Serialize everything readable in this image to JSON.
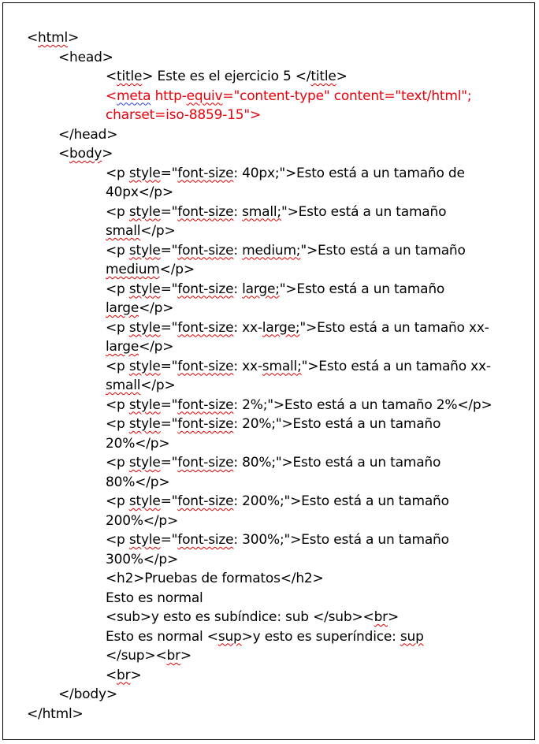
{
  "lines": [
    {
      "indent": 0,
      "red": false,
      "parts": [
        {
          "t": "<"
        },
        {
          "t": "html",
          "sq": 1
        },
        {
          "t": ">"
        }
      ]
    },
    {
      "indent": 1,
      "red": false,
      "parts": [
        {
          "t": "<head>"
        }
      ]
    },
    {
      "indent": 2,
      "red": false,
      "parts": [
        {
          "t": "<"
        },
        {
          "t": "title",
          "sq": 1
        },
        {
          "t": "> Este es el ejercicio 5 </"
        },
        {
          "t": "title",
          "sq": 1
        },
        {
          "t": ">"
        }
      ]
    },
    {
      "indent": 2,
      "red": true,
      "parts": [
        {
          "t": "<"
        },
        {
          "t": "meta",
          "sq": 2
        },
        {
          "t": " http-"
        },
        {
          "t": "equiv",
          "sq": 1
        },
        {
          "t": "=\"content-type\" content=\"text/html\";"
        }
      ]
    },
    {
      "indent": 2,
      "red": true,
      "parts": [
        {
          "t": "charset=iso-8859-15\">"
        }
      ]
    },
    {
      "indent": 1,
      "red": false,
      "parts": [
        {
          "t": "</head>"
        }
      ]
    },
    {
      "indent": 1,
      "red": false,
      "parts": [
        {
          "t": "<"
        },
        {
          "t": "body",
          "sq": 1
        },
        {
          "t": ">"
        }
      ]
    },
    {
      "indent": 2,
      "red": false,
      "parts": [
        {
          "t": "<p "
        },
        {
          "t": "style",
          "sq": 1
        },
        {
          "t": "=\""
        },
        {
          "t": "font-size",
          "sq": 1
        },
        {
          "t": ": 40px;\">Esto está a un tamaño de"
        }
      ]
    },
    {
      "indent": 2,
      "red": false,
      "parts": [
        {
          "t": "40px</p>"
        }
      ]
    },
    {
      "indent": 2,
      "red": false,
      "parts": [
        {
          "t": "<p "
        },
        {
          "t": "style",
          "sq": 1
        },
        {
          "t": "=\""
        },
        {
          "t": "font-size",
          "sq": 1
        },
        {
          "t": ": "
        },
        {
          "t": "small;",
          "sq": 1
        },
        {
          "t": "\">Esto está a un tamaño"
        }
      ]
    },
    {
      "indent": 2,
      "red": false,
      "parts": [
        {
          "t": "small",
          "sq": 1
        },
        {
          "t": "</p>"
        }
      ]
    },
    {
      "indent": 2,
      "red": false,
      "parts": [
        {
          "t": "<p "
        },
        {
          "t": "style",
          "sq": 1
        },
        {
          "t": "=\""
        },
        {
          "t": "font-size",
          "sq": 1
        },
        {
          "t": ": "
        },
        {
          "t": "medium;",
          "sq": 1
        },
        {
          "t": "\">Esto está a un tamaño"
        }
      ]
    },
    {
      "indent": 2,
      "red": false,
      "parts": [
        {
          "t": "medium",
          "sq": 1
        },
        {
          "t": "</p>"
        }
      ]
    },
    {
      "indent": 2,
      "red": false,
      "parts": [
        {
          "t": "<p "
        },
        {
          "t": "style",
          "sq": 1
        },
        {
          "t": "=\""
        },
        {
          "t": "font-size",
          "sq": 1
        },
        {
          "t": ": "
        },
        {
          "t": "large;",
          "sq": 1
        },
        {
          "t": "\">Esto está a un tamaño"
        }
      ]
    },
    {
      "indent": 2,
      "red": false,
      "parts": [
        {
          "t": "large",
          "sq": 1
        },
        {
          "t": "</p>"
        }
      ]
    },
    {
      "indent": 2,
      "red": false,
      "parts": [
        {
          "t": "<p "
        },
        {
          "t": "style",
          "sq": 1
        },
        {
          "t": "=\""
        },
        {
          "t": "font-size",
          "sq": 1
        },
        {
          "t": ": xx-"
        },
        {
          "t": "large;",
          "sq": 1
        },
        {
          "t": "\">Esto está a un tamaño xx-"
        }
      ]
    },
    {
      "indent": 2,
      "red": false,
      "parts": [
        {
          "t": "large",
          "sq": 1
        },
        {
          "t": "</p>"
        }
      ]
    },
    {
      "indent": 2,
      "red": false,
      "parts": [
        {
          "t": "<p "
        },
        {
          "t": "style",
          "sq": 1
        },
        {
          "t": "=\""
        },
        {
          "t": "font-size",
          "sq": 1
        },
        {
          "t": ": xx-"
        },
        {
          "t": "small;",
          "sq": 1
        },
        {
          "t": "\">Esto está a un tamaño xx-"
        }
      ]
    },
    {
      "indent": 2,
      "red": false,
      "parts": [
        {
          "t": "small",
          "sq": 1
        },
        {
          "t": "</p>"
        }
      ]
    },
    {
      "indent": 2,
      "red": false,
      "parts": [
        {
          "t": "<p "
        },
        {
          "t": "style",
          "sq": 1
        },
        {
          "t": "=\""
        },
        {
          "t": "font-size",
          "sq": 1
        },
        {
          "t": ": 2%;\">Esto está a un tamaño 2%</p>"
        }
      ]
    },
    {
      "indent": 2,
      "red": false,
      "parts": [
        {
          "t": "<p "
        },
        {
          "t": "style",
          "sq": 1
        },
        {
          "t": "=\""
        },
        {
          "t": "font-size",
          "sq": 1
        },
        {
          "t": ": 20%;\">Esto está a un tamaño"
        }
      ]
    },
    {
      "indent": 2,
      "red": false,
      "parts": [
        {
          "t": "20%</p>"
        }
      ]
    },
    {
      "indent": 2,
      "red": false,
      "parts": [
        {
          "t": "<p "
        },
        {
          "t": "style",
          "sq": 1
        },
        {
          "t": "=\""
        },
        {
          "t": "font-size",
          "sq": 1
        },
        {
          "t": ": 80%;\">Esto está a un tamaño"
        }
      ]
    },
    {
      "indent": 2,
      "red": false,
      "parts": [
        {
          "t": "80%</p>"
        }
      ]
    },
    {
      "indent": 2,
      "red": false,
      "parts": [
        {
          "t": "<p "
        },
        {
          "t": "style",
          "sq": 1
        },
        {
          "t": "=\""
        },
        {
          "t": "font-size",
          "sq": 1
        },
        {
          "t": ": 200%;\">Esto está a un tamaño"
        }
      ]
    },
    {
      "indent": 2,
      "red": false,
      "parts": [
        {
          "t": "200%</p>"
        }
      ]
    },
    {
      "indent": 2,
      "red": false,
      "parts": [
        {
          "t": "<p "
        },
        {
          "t": "style",
          "sq": 1
        },
        {
          "t": "=\""
        },
        {
          "t": "font-size",
          "sq": 1
        },
        {
          "t": ": 300%;\">Esto está a un tamaño"
        }
      ]
    },
    {
      "indent": 2,
      "red": false,
      "parts": [
        {
          "t": "300%</p>"
        }
      ]
    },
    {
      "indent": 2,
      "red": false,
      "parts": [
        {
          "t": "<h2>Pruebas de formatos</h2>"
        }
      ]
    },
    {
      "indent": 2,
      "red": false,
      "parts": [
        {
          "t": "Esto es normal"
        }
      ]
    },
    {
      "indent": 2,
      "red": false,
      "parts": [
        {
          "t": "<sub>y esto es subíndice: sub </sub><"
        },
        {
          "t": "br",
          "sq": 1
        },
        {
          "t": ">"
        }
      ]
    },
    {
      "indent": 2,
      "red": false,
      "parts": [
        {
          "t": "Esto es normal <"
        },
        {
          "t": "sup",
          "sq": 1
        },
        {
          "t": ">y esto es superíndice: "
        },
        {
          "t": "sup",
          "sq": 1
        }
      ]
    },
    {
      "indent": 2,
      "red": false,
      "parts": [
        {
          "t": "</sup><"
        },
        {
          "t": "br",
          "sq": 1
        },
        {
          "t": ">"
        }
      ]
    },
    {
      "indent": 2,
      "red": false,
      "parts": [
        {
          "t": "<"
        },
        {
          "t": "br",
          "sq": 1
        },
        {
          "t": ">"
        }
      ]
    },
    {
      "indent": 1,
      "red": false,
      "parts": [
        {
          "t": "</body>"
        }
      ]
    },
    {
      "indent": 0,
      "red": false,
      "parts": [
        {
          "t": "</html>"
        }
      ]
    }
  ],
  "colors": {
    "text": "#000000",
    "code_red": "#e8000b",
    "spell_red": "#e00000",
    "grammar_blue": "#2b3fd6"
  }
}
